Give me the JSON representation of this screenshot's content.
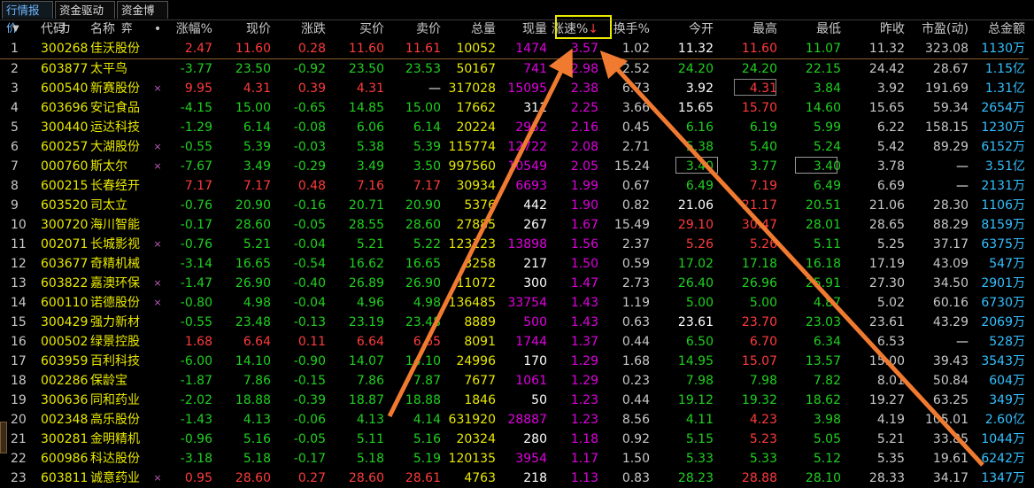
{
  "tabs": [
    "行情报价",
    "资金驱动力",
    "资金博弈"
  ],
  "columns": {
    "sort": "▼",
    "code": "代码",
    "name": "名称",
    "dot": "•",
    "pct": "涨幅%",
    "price": "现价",
    "chg": "涨跌",
    "bid": "买价",
    "ask": "卖价",
    "vol": "总量",
    "cur": "现量",
    "speed": "涨速%",
    "turn": "换手%",
    "open": "今开",
    "high": "最高",
    "low": "最低",
    "prev": "昨收",
    "pe": "市盈(动)",
    "amount": "总金额"
  },
  "sort_indicator": "↓",
  "rows": [
    {
      "idx": "1",
      "code": "300268",
      "name": "佳沃股份",
      "mark": "",
      "pct": "2.47",
      "price": "11.60",
      "chg": "0.28",
      "bid": "11.60",
      "ask": "11.61",
      "vol": "10052",
      "cur": "1474",
      "speed": "3.57",
      "turn": "1.02",
      "open": "11.32",
      "high": "11.60",
      "low": "11.07",
      "prev": "11.32",
      "pe": "323.08",
      "amount": "1130万",
      "d": "up",
      "curc": "pk",
      "openc": "wt",
      "highc": "up",
      "lowc": "dn"
    },
    {
      "idx": "2",
      "code": "603877",
      "name": "太平鸟",
      "mark": "",
      "pct": "-3.77",
      "price": "23.50",
      "chg": "-0.92",
      "bid": "23.50",
      "ask": "23.53",
      "vol": "50167",
      "cur": "741",
      "speed": "2.98",
      "turn": "2.52",
      "open": "24.20",
      "high": "24.20",
      "low": "22.15",
      "prev": "24.42",
      "pe": "28.67",
      "amount": "1.15亿",
      "d": "dn",
      "curc": "pk",
      "openc": "dn",
      "highc": "dn",
      "lowc": "dn"
    },
    {
      "idx": "3",
      "code": "600540",
      "name": "新赛股份",
      "mark": "×",
      "pct": "9.95",
      "price": "4.31",
      "chg": "0.39",
      "bid": "4.31",
      "ask": "—",
      "vol": "317028",
      "cur": "15095",
      "speed": "2.38",
      "turn": "6.73",
      "open": "3.92",
      "high": "4.31",
      "low": "3.84",
      "prev": "3.92",
      "pe": "191.69",
      "amount": "1.31亿",
      "d": "up",
      "curc": "pk",
      "openc": "wt",
      "highc": "up",
      "lowc": "dn"
    },
    {
      "idx": "4",
      "code": "603696",
      "name": "安记食品",
      "mark": "",
      "pct": "-4.15",
      "price": "15.00",
      "chg": "-0.65",
      "bid": "14.85",
      "ask": "15.00",
      "vol": "17662",
      "cur": "311",
      "speed": "2.25",
      "turn": "3.66",
      "open": "15.65",
      "high": "15.70",
      "low": "14.60",
      "prev": "15.65",
      "pe": "59.34",
      "amount": "2654万",
      "d": "dn",
      "curc": "wt",
      "openc": "wt",
      "highc": "up",
      "lowc": "dn"
    },
    {
      "idx": "5",
      "code": "300440",
      "name": "运达科技",
      "mark": "",
      "pct": "-1.29",
      "price": "6.14",
      "chg": "-0.08",
      "bid": "6.06",
      "ask": "6.14",
      "vol": "20224",
      "cur": "2952",
      "speed": "2.16",
      "turn": "0.45",
      "open": "6.16",
      "high": "6.19",
      "low": "5.99",
      "prev": "6.22",
      "pe": "158.15",
      "amount": "1230万",
      "d": "dn",
      "curc": "pk",
      "openc": "dn",
      "highc": "dn",
      "lowc": "dn"
    },
    {
      "idx": "6",
      "code": "600257",
      "name": "大湖股份",
      "mark": "×",
      "pct": "-0.55",
      "price": "5.39",
      "chg": "-0.03",
      "bid": "5.38",
      "ask": "5.39",
      "vol": "115774",
      "cur": "12722",
      "speed": "2.08",
      "turn": "2.71",
      "open": "5.38",
      "high": "5.40",
      "low": "5.24",
      "prev": "5.42",
      "pe": "89.29",
      "amount": "6152万",
      "d": "dn",
      "curc": "pk",
      "openc": "dn",
      "highc": "dn",
      "lowc": "dn"
    },
    {
      "idx": "7",
      "code": "000760",
      "name": "斯太尔",
      "mark": "×",
      "pct": "-7.67",
      "price": "3.49",
      "chg": "-0.29",
      "bid": "3.49",
      "ask": "3.50",
      "vol": "997560",
      "cur": "10549",
      "speed": "2.05",
      "turn": "15.24",
      "open": "3.40",
      "high": "3.77",
      "low": "3.40",
      "prev": "3.78",
      "pe": "—",
      "amount": "3.51亿",
      "d": "dn",
      "curc": "pk",
      "openc": "dn",
      "highc": "dn",
      "lowc": "dn"
    },
    {
      "idx": "8",
      "code": "600215",
      "name": "长春经开",
      "mark": "",
      "pct": "7.17",
      "price": "7.17",
      "chg": "0.48",
      "bid": "7.16",
      "ask": "7.17",
      "vol": "30934",
      "cur": "6693",
      "speed": "1.99",
      "turn": "0.67",
      "open": "6.49",
      "high": "7.19",
      "low": "6.49",
      "prev": "6.69",
      "pe": "—",
      "amount": "2131万",
      "d": "up",
      "curc": "pk",
      "openc": "dn",
      "highc": "up",
      "lowc": "dn"
    },
    {
      "idx": "9",
      "code": "603520",
      "name": "司太立",
      "mark": "",
      "pct": "-0.76",
      "price": "20.90",
      "chg": "-0.16",
      "bid": "20.71",
      "ask": "20.90",
      "vol": "5376",
      "cur": "442",
      "speed": "1.90",
      "turn": "0.82",
      "open": "21.06",
      "high": "21.17",
      "low": "20.51",
      "prev": "21.06",
      "pe": "28.30",
      "amount": "1106万",
      "d": "dn",
      "curc": "wt",
      "openc": "wt",
      "highc": "up",
      "lowc": "dn"
    },
    {
      "idx": "10",
      "code": "300720",
      "name": "海川智能",
      "mark": "",
      "pct": "-0.17",
      "price": "28.60",
      "chg": "-0.05",
      "bid": "28.55",
      "ask": "28.60",
      "vol": "27885",
      "cur": "267",
      "speed": "1.67",
      "turn": "15.49",
      "open": "29.10",
      "high": "30.47",
      "low": "28.01",
      "prev": "28.65",
      "pe": "88.29",
      "amount": "8159万",
      "d": "dn",
      "curc": "wt",
      "openc": "up",
      "highc": "up",
      "lowc": "dn"
    },
    {
      "idx": "11",
      "code": "002071",
      "name": "长城影视",
      "mark": "×",
      "pct": "-0.76",
      "price": "5.21",
      "chg": "-0.04",
      "bid": "5.21",
      "ask": "5.22",
      "vol": "123123",
      "cur": "13898",
      "speed": "1.56",
      "turn": "2.37",
      "open": "5.26",
      "high": "5.26",
      "low": "5.11",
      "prev": "5.25",
      "pe": "37.17",
      "amount": "6375万",
      "d": "dn",
      "curc": "pk",
      "openc": "up",
      "highc": "up",
      "lowc": "dn"
    },
    {
      "idx": "12",
      "code": "603677",
      "name": "奇精机械",
      "mark": "",
      "pct": "-3.14",
      "price": "16.65",
      "chg": "-0.54",
      "bid": "16.62",
      "ask": "16.65",
      "vol": "3258",
      "cur": "217",
      "speed": "1.50",
      "turn": "0.59",
      "open": "17.02",
      "high": "17.18",
      "low": "16.18",
      "prev": "17.19",
      "pe": "43.09",
      "amount": "547万",
      "d": "dn",
      "curc": "wt",
      "openc": "dn",
      "highc": "dn",
      "lowc": "dn"
    },
    {
      "idx": "13",
      "code": "603822",
      "name": "嘉澳环保",
      "mark": "×",
      "pct": "-1.47",
      "price": "26.90",
      "chg": "-0.40",
      "bid": "26.89",
      "ask": "26.90",
      "vol": "11072",
      "cur": "300",
      "speed": "1.47",
      "turn": "2.73",
      "open": "26.40",
      "high": "26.96",
      "low": "25.91",
      "prev": "27.30",
      "pe": "34.50",
      "amount": "2901万",
      "d": "dn",
      "curc": "wt",
      "openc": "dn",
      "highc": "dn",
      "lowc": "dn"
    },
    {
      "idx": "14",
      "code": "600110",
      "name": "诺德股份",
      "mark": "×",
      "pct": "-0.80",
      "price": "4.98",
      "chg": "-0.04",
      "bid": "4.96",
      "ask": "4.98",
      "vol": "136485",
      "cur": "33754",
      "speed": "1.43",
      "turn": "1.19",
      "open": "5.00",
      "high": "5.00",
      "low": "4.87",
      "prev": "5.02",
      "pe": "60.16",
      "amount": "6730万",
      "d": "dn",
      "curc": "pk",
      "openc": "dn",
      "highc": "dn",
      "lowc": "dn"
    },
    {
      "idx": "15",
      "code": "300429",
      "name": "强力新材",
      "mark": "",
      "pct": "-0.55",
      "price": "23.48",
      "chg": "-0.13",
      "bid": "23.19",
      "ask": "23.48",
      "vol": "8889",
      "cur": "500",
      "speed": "1.43",
      "turn": "0.63",
      "open": "23.61",
      "high": "23.70",
      "low": "23.03",
      "prev": "23.61",
      "pe": "43.29",
      "amount": "2069万",
      "d": "dn",
      "curc": "pk",
      "openc": "wt",
      "highc": "up",
      "lowc": "dn"
    },
    {
      "idx": "16",
      "code": "000502",
      "name": "绿景控股",
      "mark": "",
      "pct": "1.68",
      "price": "6.64",
      "chg": "0.11",
      "bid": "6.64",
      "ask": "6.65",
      "vol": "8091",
      "cur": "1744",
      "speed": "1.37",
      "turn": "0.44",
      "open": "6.50",
      "high": "6.70",
      "low": "6.34",
      "prev": "6.53",
      "pe": "—",
      "amount": "528万",
      "d": "up",
      "curc": "pk",
      "openc": "dn",
      "highc": "up",
      "lowc": "dn"
    },
    {
      "idx": "17",
      "code": "603959",
      "name": "百利科技",
      "mark": "",
      "pct": "-6.00",
      "price": "14.10",
      "chg": "-0.90",
      "bid": "14.07",
      "ask": "14.10",
      "vol": "24996",
      "cur": "170",
      "speed": "1.29",
      "turn": "1.68",
      "open": "14.95",
      "high": "15.07",
      "low": "13.57",
      "prev": "15.00",
      "pe": "39.43",
      "amount": "3543万",
      "d": "dn",
      "curc": "wt",
      "openc": "dn",
      "highc": "up",
      "lowc": "dn"
    },
    {
      "idx": "18",
      "code": "002286",
      "name": "保龄宝",
      "mark": "",
      "pct": "-1.87",
      "price": "7.86",
      "chg": "-0.15",
      "bid": "7.86",
      "ask": "7.87",
      "vol": "7677",
      "cur": "1061",
      "speed": "1.29",
      "turn": "0.23",
      "open": "7.98",
      "high": "7.98",
      "low": "7.82",
      "prev": "8.01",
      "pe": "50.84",
      "amount": "604万",
      "d": "dn",
      "curc": "pk",
      "openc": "dn",
      "highc": "dn",
      "lowc": "dn"
    },
    {
      "idx": "19",
      "code": "300636",
      "name": "同和药业",
      "mark": "",
      "pct": "-2.02",
      "price": "18.88",
      "chg": "-0.39",
      "bid": "18.87",
      "ask": "18.88",
      "vol": "1846",
      "cur": "50",
      "speed": "1.23",
      "turn": "0.44",
      "open": "19.12",
      "high": "19.32",
      "low": "18.62",
      "prev": "19.27",
      "pe": "63.25",
      "amount": "349万",
      "d": "dn",
      "curc": "wt",
      "openc": "dn",
      "highc": "dn",
      "lowc": "dn"
    },
    {
      "idx": "20",
      "code": "002348",
      "name": "高乐股份",
      "mark": "",
      "pct": "-1.43",
      "price": "4.13",
      "chg": "-0.06",
      "bid": "4.13",
      "ask": "4.14",
      "vol": "631920",
      "cur": "28887",
      "speed": "1.23",
      "turn": "8.56",
      "open": "4.11",
      "high": "4.23",
      "low": "3.98",
      "prev": "4.19",
      "pe": "105.01",
      "amount": "2.60亿",
      "d": "dn",
      "curc": "pk",
      "openc": "dn",
      "highc": "up",
      "lowc": "dn"
    },
    {
      "idx": "21",
      "code": "300281",
      "name": "金明精机",
      "mark": "",
      "pct": "-0.96",
      "price": "5.16",
      "chg": "-0.05",
      "bid": "5.11",
      "ask": "5.16",
      "vol": "20324",
      "cur": "280",
      "speed": "1.18",
      "turn": "0.92",
      "open": "5.15",
      "high": "5.23",
      "low": "5.05",
      "prev": "5.21",
      "pe": "33.85",
      "amount": "1044万",
      "d": "dn",
      "curc": "wt",
      "openc": "dn",
      "highc": "up",
      "lowc": "dn"
    },
    {
      "idx": "22",
      "code": "600986",
      "name": "科达股份",
      "mark": "",
      "pct": "-3.18",
      "price": "5.18",
      "chg": "-0.17",
      "bid": "5.18",
      "ask": "5.19",
      "vol": "120135",
      "cur": "3954",
      "speed": "1.17",
      "turn": "1.50",
      "open": "5.33",
      "high": "5.33",
      "low": "5.12",
      "prev": "5.35",
      "pe": "19.61",
      "amount": "6242万",
      "d": "dn",
      "curc": "pk",
      "openc": "dn",
      "highc": "dn",
      "lowc": "dn"
    },
    {
      "idx": "23",
      "code": "603811",
      "name": "诚意药业",
      "mark": "×",
      "pct": "0.95",
      "price": "28.60",
      "chg": "0.27",
      "bid": "28.60",
      "ask": "28.61",
      "vol": "4763",
      "cur": "218",
      "speed": "1.13",
      "turn": "0.83",
      "open": "28.23",
      "high": "28.88",
      "low": "28.10",
      "prev": "28.33",
      "pe": "34.17",
      "amount": "1347万",
      "d": "up",
      "curc": "wt",
      "openc": "dn",
      "highc": "up",
      "lowc": "dn"
    }
  ]
}
